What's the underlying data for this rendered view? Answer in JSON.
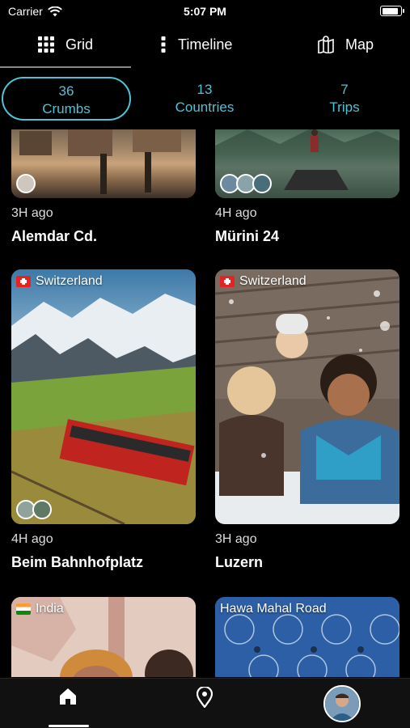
{
  "status_bar": {
    "carrier": "Carrier",
    "time": "5:07 PM",
    "battery_level": 0.95
  },
  "view_tabs": [
    {
      "label": "Grid",
      "icon": "grid-icon",
      "active": true
    },
    {
      "label": "Timeline",
      "icon": "vertical-dots-icon",
      "active": false
    },
    {
      "label": "Map",
      "icon": "map-icon",
      "active": false
    }
  ],
  "counters": [
    {
      "value": "36",
      "label": "Crumbs",
      "active": true
    },
    {
      "value": "13",
      "label": "Countries",
      "active": false
    },
    {
      "value": "7",
      "label": "Trips",
      "active": false
    }
  ],
  "accent_color": "#4fc3d6",
  "cards": [
    {
      "time_ago": "3H ago",
      "place": "Alemdar Cd.",
      "tag": "",
      "flag": "",
      "thumb_count": 1
    },
    {
      "time_ago": "4H ago",
      "place": "Mürini 24",
      "tag": "",
      "flag": "",
      "thumb_count": 3
    },
    {
      "time_ago": "4H ago",
      "place": "Beim Bahnhofplatz",
      "tag": "Switzerland",
      "flag": "swiss-flag-icon",
      "thumb_count": 2
    },
    {
      "time_ago": "3H ago",
      "place": "Luzern",
      "tag": "Switzerland",
      "flag": "swiss-flag-icon",
      "thumb_count": 0
    },
    {
      "time_ago": "",
      "place": "",
      "tag": "India",
      "flag": "india-flag-icon",
      "thumb_count": 0
    },
    {
      "time_ago": "",
      "place": "",
      "tag": "Hawa Mahal Road",
      "flag": "",
      "thumb_count": 0
    }
  ],
  "tab_bar": [
    {
      "icon": "home-icon",
      "active": true
    },
    {
      "icon": "location-pin-icon",
      "active": false
    },
    {
      "icon": "profile-avatar",
      "active": false
    }
  ]
}
